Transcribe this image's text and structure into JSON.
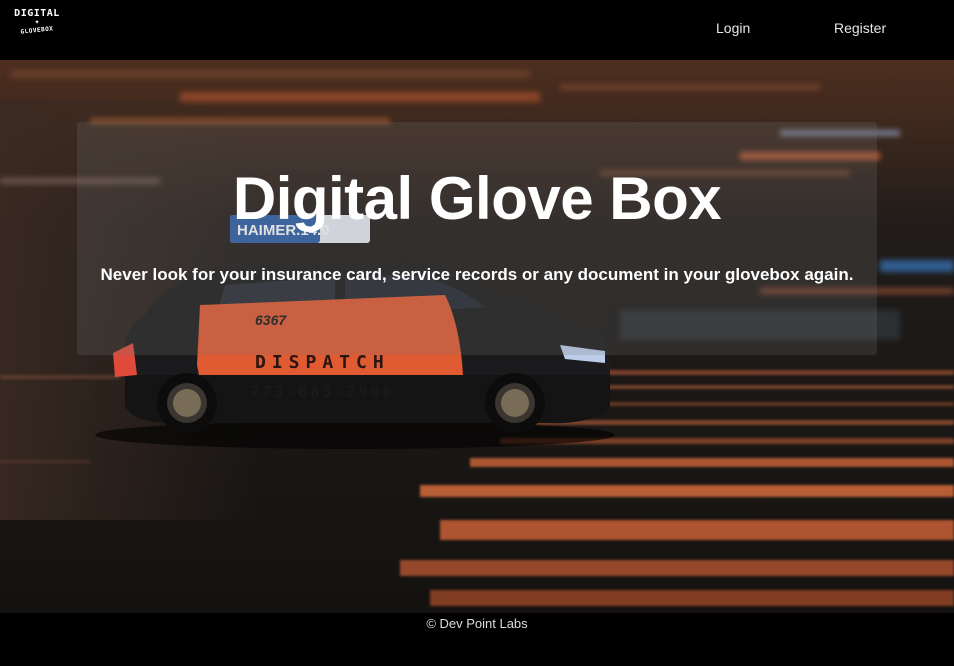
{
  "header": {
    "logo": {
      "top_text": "DIGITAL",
      "bottom_text": "GLOVEBOX",
      "star": "✦"
    },
    "nav": {
      "login_label": "Login",
      "register_label": "Register"
    }
  },
  "hero": {
    "title": "Digital Glove Box",
    "subtitle": "Never look for your insurance card, service records or any document in your glovebox again.",
    "taxi": {
      "roof_sign": "HAIMER.14.0",
      "car_number": "6367",
      "door_text": "DISPATCH",
      "phone": "773-685-2900"
    }
  },
  "footer": {
    "copyright": "© Dev Point Labs"
  },
  "colors": {
    "navbar": "#000000",
    "streak_orange": "#e0693a",
    "taxi_orange": "#e05a32",
    "panel": "rgba(120,120,120,0.22)"
  }
}
